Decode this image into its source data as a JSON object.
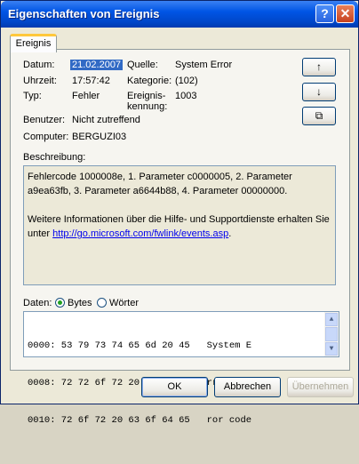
{
  "window": {
    "title": "Eigenschaften von Ereignis",
    "help": "?",
    "close": "✕"
  },
  "tab": {
    "label": "Ereignis"
  },
  "fields": {
    "datum_label": "Datum:",
    "datum_value": "21.02.2007",
    "uhrzeit_label": "Uhrzeit:",
    "uhrzeit_value": "17:57:42",
    "typ_label": "Typ:",
    "typ_value": "Fehler",
    "benutzer_label": "Benutzer:",
    "benutzer_value": "Nicht zutreffend",
    "computer_label": "Computer:",
    "computer_value": "BERGUZI03",
    "quelle_label": "Quelle:",
    "quelle_value": "System Error",
    "kategorie_label": "Kategorie:",
    "kategorie_value": "(102)",
    "kennung_label_1": "Ereignis-",
    "kennung_label_2": "kennung:",
    "kennung_value": "1003"
  },
  "side_buttons": {
    "up": "↑",
    "down": "↓",
    "copy": "⧉"
  },
  "description": {
    "label": "Beschreibung:",
    "para1": "Fehlercode 1000008e, 1. Parameter c0000005, 2. Parameter a9ea63fb, 3. Parameter a6644b88, 4. Parameter 00000000.",
    "para2": "Weitere Informationen über die Hilfe- und Supportdienste erhalten Sie unter ",
    "link": "http://go.microsoft.com/fwlink/events.asp",
    "tail": "."
  },
  "data": {
    "label": "Daten:",
    "opt_bytes": "Bytes",
    "opt_woerter": "Wörter",
    "selected": "Bytes",
    "rows": [
      "0000: 53 79 73 74 65 6d 20 45   System E",
      "0008: 72 72 6f 72 20 20 45 72   rror  Er",
      "0010: 72 6f 72 20 63 6f 64 65   ror code"
    ]
  },
  "buttons": {
    "ok": "OK",
    "cancel": "Abbrechen",
    "apply": "Übernehmen"
  }
}
